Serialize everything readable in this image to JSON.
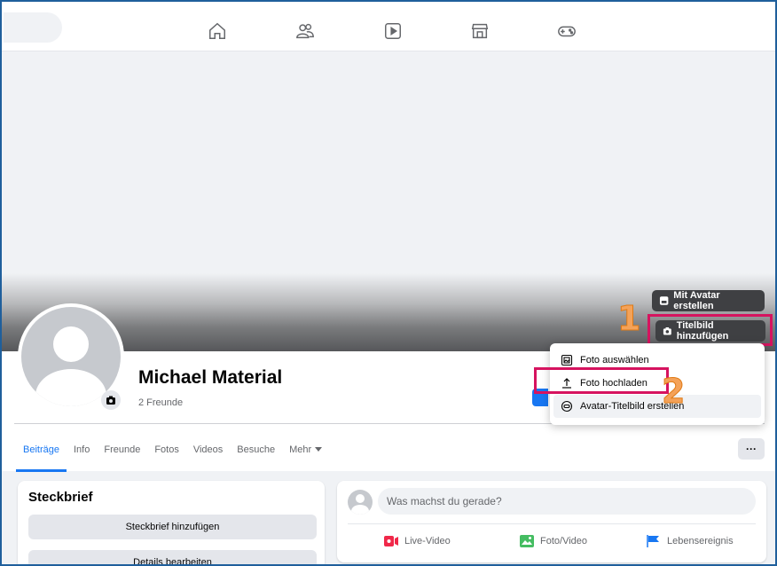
{
  "nav": {
    "icons": [
      "home-icon",
      "friends-icon",
      "watch-icon",
      "marketplace-icon",
      "gaming-icon"
    ]
  },
  "cover": {
    "avatar_cover_button": "Mit Avatar erstellen",
    "add_cover_button": "Titelbild hinzufügen"
  },
  "callouts": {
    "one": "1",
    "two": "2"
  },
  "profile": {
    "name": "Michael Material",
    "friends": "2 Freunde"
  },
  "dropdown": {
    "items": [
      {
        "label": "Foto auswählen",
        "icon": "image-select-icon"
      },
      {
        "label": "Foto hochladen",
        "icon": "upload-icon"
      },
      {
        "label": "Avatar-Titelbild erstellen",
        "icon": "avatar-icon"
      }
    ]
  },
  "tabs": {
    "items": [
      "Beiträge",
      "Info",
      "Freunde",
      "Fotos",
      "Videos",
      "Besuche"
    ],
    "more": "Mehr",
    "dots": "···"
  },
  "steckbrief": {
    "title": "Steckbrief",
    "add_button": "Steckbrief hinzufügen",
    "edit_button": "Details bearbeiten"
  },
  "composer": {
    "placeholder": "Was machst du gerade?",
    "actions": [
      "Live-Video",
      "Foto/Video",
      "Lebensereignis"
    ]
  },
  "colors": {
    "accent": "#1877f2",
    "highlight_box": "#d6135f",
    "callout": "#f4a259",
    "frame": "#1f5f9c"
  }
}
